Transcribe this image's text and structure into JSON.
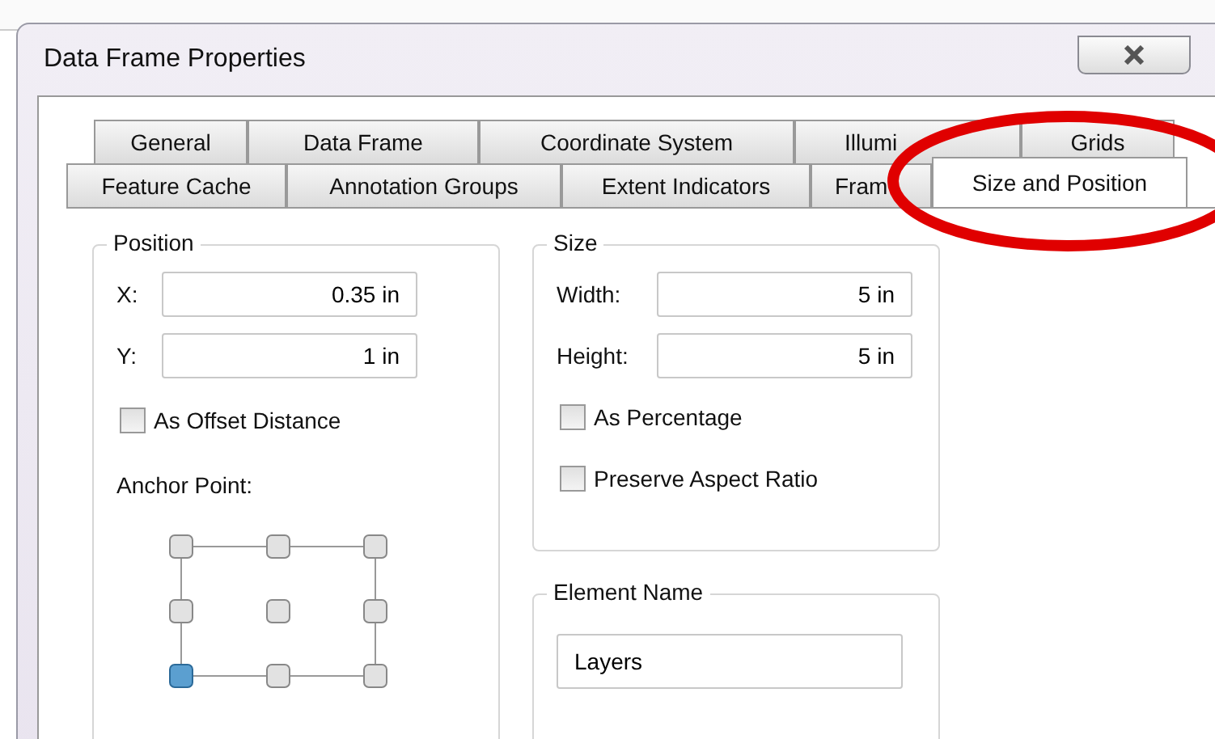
{
  "window": {
    "title": "Data Frame Properties"
  },
  "tab_rows": [
    {
      "tabs": [
        {
          "label": "General",
          "selected": false
        },
        {
          "label": "Data Frame",
          "selected": false
        },
        {
          "label": "Coordinate System",
          "selected": false
        },
        {
          "label": "Illumi",
          "selected": false
        },
        {
          "label": "Grids",
          "selected": false
        }
      ]
    },
    {
      "tabs": [
        {
          "label": "Feature Cache",
          "selected": false
        },
        {
          "label": "Annotation Groups",
          "selected": false
        },
        {
          "label": "Extent Indicators",
          "selected": false
        },
        {
          "label": "Fram",
          "selected": false
        },
        {
          "label": "Size and Position",
          "selected": true
        }
      ]
    }
  ],
  "position": {
    "title": "Position",
    "fields": [
      {
        "label": "X:",
        "value": "0.35 in"
      },
      {
        "label": "Y:",
        "value": "1 in"
      }
    ],
    "checkbox": {
      "label": "As Offset Distance",
      "checked": false
    },
    "anchor": {
      "label": "Anchor Point:",
      "points": [
        {
          "selected": false
        },
        {
          "selected": false
        },
        {
          "selected": false
        },
        {
          "selected": false
        },
        {
          "selected": false
        },
        {
          "selected": false
        },
        {
          "selected": true
        },
        {
          "selected": false
        },
        {
          "selected": false
        }
      ]
    }
  },
  "size": {
    "title": "Size",
    "fields": [
      {
        "label": "Width:",
        "value": "5 in"
      },
      {
        "label": "Height:",
        "value": "5 in"
      }
    ],
    "checkboxes": [
      {
        "label": "As Percentage",
        "checked": false
      },
      {
        "label": "Preserve Aspect Ratio",
        "checked": false
      }
    ]
  },
  "element_name": {
    "title": "Element Name",
    "value": "Layers"
  }
}
